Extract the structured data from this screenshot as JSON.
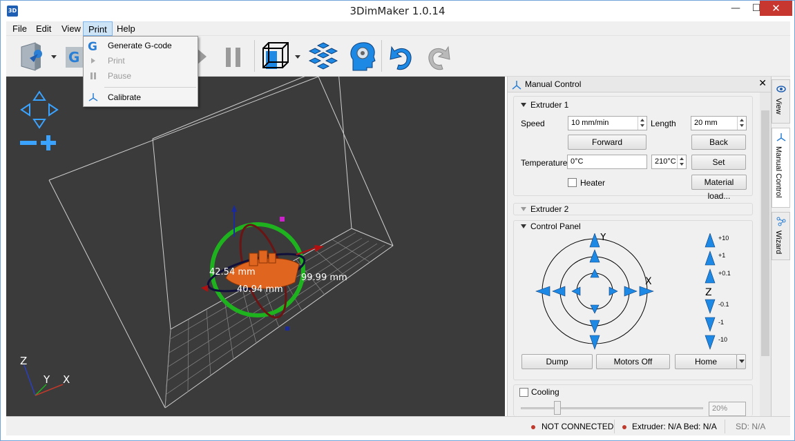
{
  "window": {
    "title": "3DimMaker 1.0.14",
    "app_icon_text": "3D",
    "minimize": "—",
    "maximize": "☐",
    "close": "✕"
  },
  "menu": {
    "file": "File",
    "edit": "Edit",
    "view": "View",
    "print": "Print",
    "help": "Help"
  },
  "print_menu": {
    "generate_gcode": "Generate G-code",
    "print": "Print",
    "pause": "Pause",
    "calibrate": "Calibrate"
  },
  "viewport": {
    "dim_a": "42.54 mm",
    "dim_b": "40.94 mm",
    "dim_c": "99.99 mm",
    "axis_z": "Z",
    "axis_y": "Y",
    "axis_x": "X"
  },
  "panel": {
    "title": "Manual Control",
    "close": "✕",
    "extruder1": {
      "title": "Extruder 1",
      "speed_label": "Speed",
      "speed_value": "10 mm/min",
      "length_label": "Length",
      "length_value": "20 mm",
      "forward": "Forward",
      "back": "Back",
      "temp_label": "Temperature",
      "temp_value": "0°C",
      "temp_target": "210°C",
      "set": "Set",
      "heater": "Heater",
      "material_load": "Material load..."
    },
    "extruder2": {
      "title": "Extruder 2"
    },
    "control_panel": {
      "title": "Control Panel",
      "axis_y": "Y",
      "axis_x": "X",
      "axis_z": "Z",
      "z_steps": [
        "+10",
        "+1",
        "+0.1",
        "-0.1",
        "-1",
        "-10"
      ],
      "dump": "Dump",
      "motors_off": "Motors Off",
      "home": "Home"
    },
    "cooling": {
      "label": "Cooling",
      "value": "20%"
    }
  },
  "side_tabs": {
    "view": "View",
    "manual": "Manual Control",
    "wizard": "Wizard"
  },
  "status": {
    "connection": "NOT CONNECTED",
    "temps": "Extruder: N/A Bed: N/A",
    "sd": "SD: N/A"
  },
  "colors": {
    "accent": "#2a7fd4",
    "arrow": "#1e88e5",
    "viewport_bg": "#3b3b3b",
    "model": "#e0651e",
    "ring_green": "#1fb21f",
    "status_led": "#c0392b"
  }
}
